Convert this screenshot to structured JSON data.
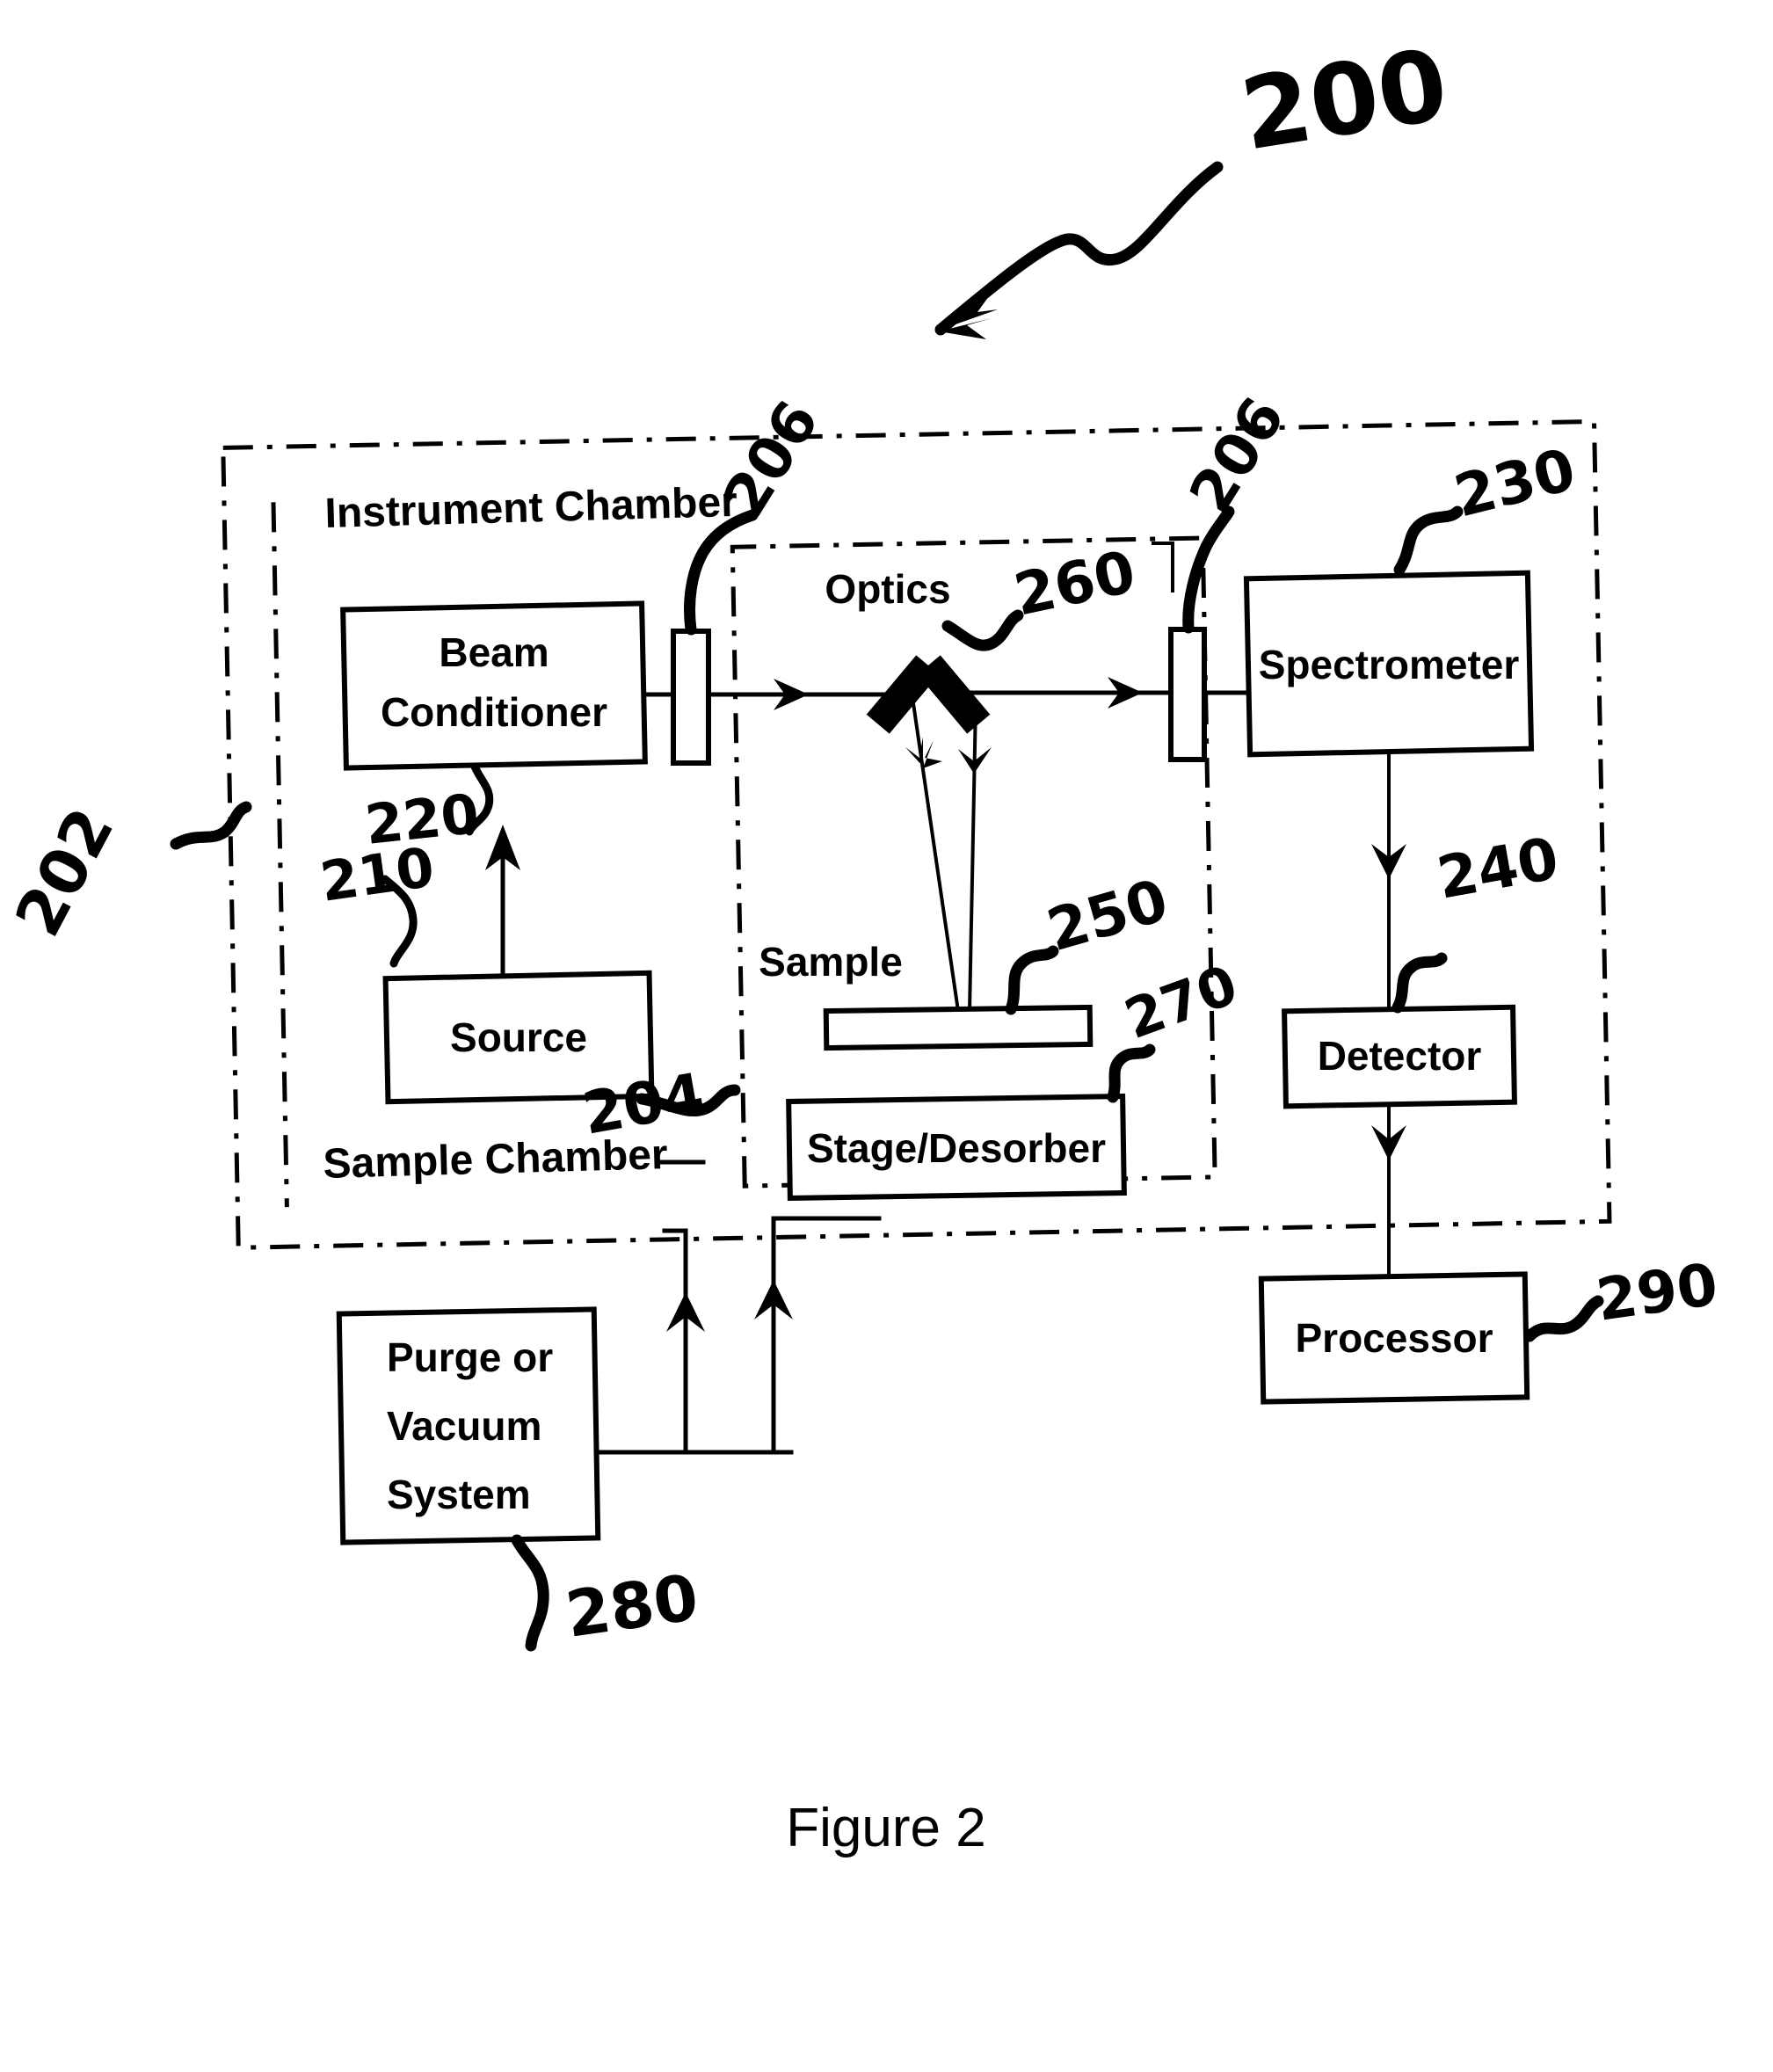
{
  "figure": {
    "caption": "Figure 2",
    "system_ref": "200"
  },
  "chambers": {
    "instrument": {
      "label": "Instrument Chamber",
      "ref": "202"
    },
    "sample": {
      "label": "Sample Chamber",
      "ref": "204"
    }
  },
  "blocks": {
    "beam_conditioner": {
      "line1": "Beam",
      "line2": "Conditioner",
      "ref": "220"
    },
    "source": {
      "label": "Source",
      "ref": "210"
    },
    "spectrometer": {
      "label": "Spectrometer",
      "ref": "230"
    },
    "detector": {
      "label": "Detector",
      "ref": "240"
    },
    "processor": {
      "label": "Processor",
      "ref": "290"
    },
    "stage_desorber": {
      "label": "Stage/Desorber",
      "ref": "270"
    },
    "purge_vacuum": {
      "line1": "Purge or",
      "line2": "Vacuum",
      "line3": "System",
      "ref": "280"
    }
  },
  "elements": {
    "optics": {
      "label": "Optics",
      "ref": "260"
    },
    "sample": {
      "label": "Sample",
      "ref": "250"
    },
    "window_left": {
      "ref": "206"
    },
    "window_right": {
      "ref": "206"
    }
  }
}
